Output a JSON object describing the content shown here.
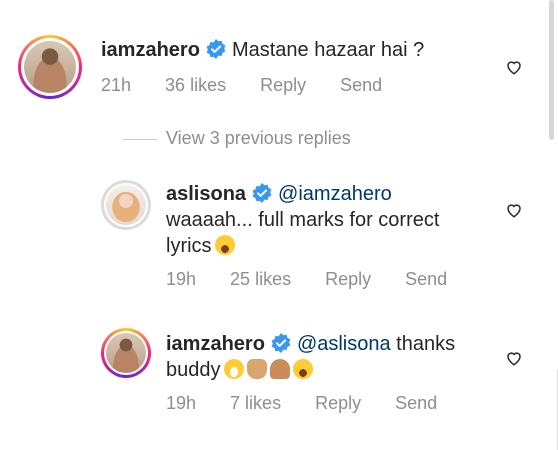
{
  "comments": [
    {
      "username": "iamzahero",
      "text": "Mastane hazaar hai ?",
      "time": "21h",
      "likes": "36 likes",
      "reply": "Reply",
      "send": "Send"
    }
  ],
  "view_replies": "View 3 previous replies",
  "replies": [
    {
      "username": "aslisona",
      "mention": "@iamzahero",
      "text_line1": "waaaah... full marks for correct",
      "text_line2": "lyrics",
      "time": "19h",
      "likes": "25 likes",
      "reply": "Reply",
      "send": "Send"
    },
    {
      "username": "iamzahero",
      "mention": "@aslisona",
      "text_line1_after": " thanks",
      "text_line2": "buddy",
      "time": "19h",
      "likes": "7 likes",
      "reply": "Reply",
      "send": "Send"
    }
  ],
  "icons": {
    "verified": "verified-badge-icon",
    "heart": "heart-outline-icon"
  },
  "colors": {
    "verified_blue": "#3897f0",
    "mention_blue": "#00376b",
    "meta_gray": "#8e8e8e"
  }
}
